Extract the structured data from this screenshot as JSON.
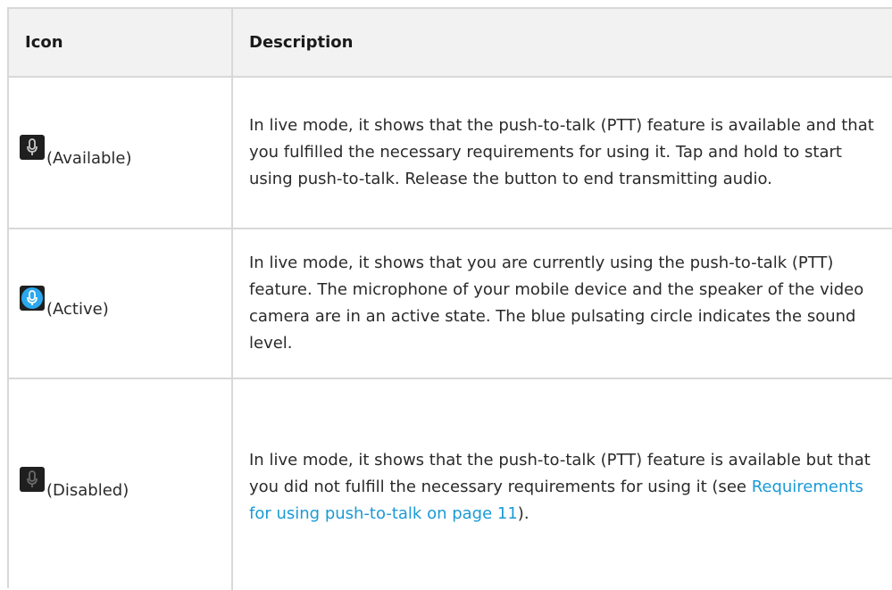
{
  "table": {
    "headers": {
      "icon": "Icon",
      "description": "Description"
    },
    "rows": [
      {
        "icon_name": "microphone-available-icon",
        "icon_label": "(Available)",
        "description": "In live mode, it shows that the push-to-talk (PTT) feature is available and that you fulfilled the necessary requirements for using it. Tap and hold to start using push-to-talk. Release the button to end transmitting audio."
      },
      {
        "icon_name": "microphone-active-icon",
        "icon_label": "(Active)",
        "description": "In live mode, it shows that you are currently using the push-to-talk (PTT) feature. The microphone of your mobile device and the speaker of the video camera are in an active state. The blue pulsating circle indicates the sound level."
      },
      {
        "icon_name": "microphone-disabled-icon",
        "icon_label": "(Disabled)",
        "description_before_link": "In live mode, it shows that the push-to-talk (PTT) feature is available but that you did not fulfill the necessary requirements for using it (see ",
        "link_text": "Requirements for using push-to-talk on page 11",
        "description_after_link": ")."
      }
    ]
  },
  "colors": {
    "border": "#d8d8d8",
    "header_bg": "#f2f2f2",
    "link": "#1b9ad6",
    "icon_bg": "#1f1f1f",
    "mic_available": "#c8c8c8",
    "mic_active": "#2aa8f0",
    "mic_disabled": "#6a6a6a"
  }
}
